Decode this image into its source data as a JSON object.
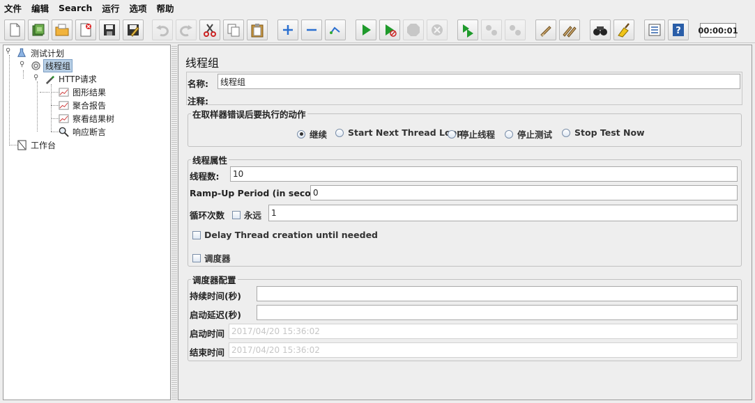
{
  "menu": [
    "文件",
    "编辑",
    "Search",
    "运行",
    "选项",
    "帮助"
  ],
  "toolbar": {
    "buttons": [
      {
        "icon": "new-icon"
      },
      {
        "icon": "templates-icon"
      },
      {
        "icon": "open-icon"
      },
      {
        "icon": "close-icon"
      },
      {
        "icon": "save-icon"
      },
      {
        "icon": "save-as-icon"
      },
      {
        "icon": "undo-icon"
      },
      {
        "icon": "redo-icon"
      },
      {
        "icon": "cut-icon"
      },
      {
        "icon": "copy-icon"
      },
      {
        "icon": "paste-icon"
      },
      {
        "icon": "expand-icon"
      },
      {
        "icon": "collapse-icon"
      },
      {
        "icon": "toggle-icon"
      },
      {
        "icon": "start-icon"
      },
      {
        "icon": "start-no-pause-icon"
      },
      {
        "icon": "stop-icon"
      },
      {
        "icon": "shutdown-icon"
      },
      {
        "icon": "remote-start-icon"
      },
      {
        "icon": "remote-stop-icon"
      },
      {
        "icon": "remote-exit-icon"
      },
      {
        "icon": "clear-icon"
      },
      {
        "icon": "clear-all-icon"
      },
      {
        "icon": "search-icon"
      },
      {
        "icon": "reset-search-icon"
      },
      {
        "icon": "function-helper-icon"
      },
      {
        "icon": "help-icon"
      }
    ],
    "timer": "00:00:01"
  },
  "tree": {
    "test_plan": "测试计划",
    "thread_group": "线程组",
    "http_request": "HTTP请求",
    "graph_results": "图形结果",
    "aggregate_report": "聚合报告",
    "view_results_tree": "察看结果树",
    "response_assertion": "响应断言",
    "workbench": "工作台"
  },
  "main": {
    "title": "线程组",
    "name_label": "名称:",
    "name_value": "线程组",
    "comment_label": "注释:",
    "sampler_error": {
      "legend": "在取样器错误后要执行的动作",
      "options": [
        "继续",
        "Start Next Thread Loop",
        "停止线程",
        "停止测试",
        "Stop Test Now"
      ],
      "selected": "继续"
    },
    "thread_props": {
      "legend": "线程属性",
      "threads_label": "线程数:",
      "threads_value": "10",
      "rampup_label": "Ramp-Up Period (in seconds):",
      "rampup_value": "0",
      "loop_label": "循环次数",
      "forever_label": "永远",
      "forever_checked": false,
      "loop_value": "1",
      "delay_label": "Delay Thread creation until needed",
      "delay_checked": false,
      "scheduler_label": "调度器",
      "scheduler_checked": false
    },
    "scheduler_config": {
      "legend": "调度器配置",
      "duration_label": "持续时间(秒)",
      "duration_value": "",
      "delay_label": "启动延迟(秒)",
      "delay_value": "",
      "start_label": "启动时间",
      "start_value": "2017/04/20 15:36:02",
      "end_label": "结束时间",
      "end_value": "2017/04/20 15:36:02"
    }
  }
}
